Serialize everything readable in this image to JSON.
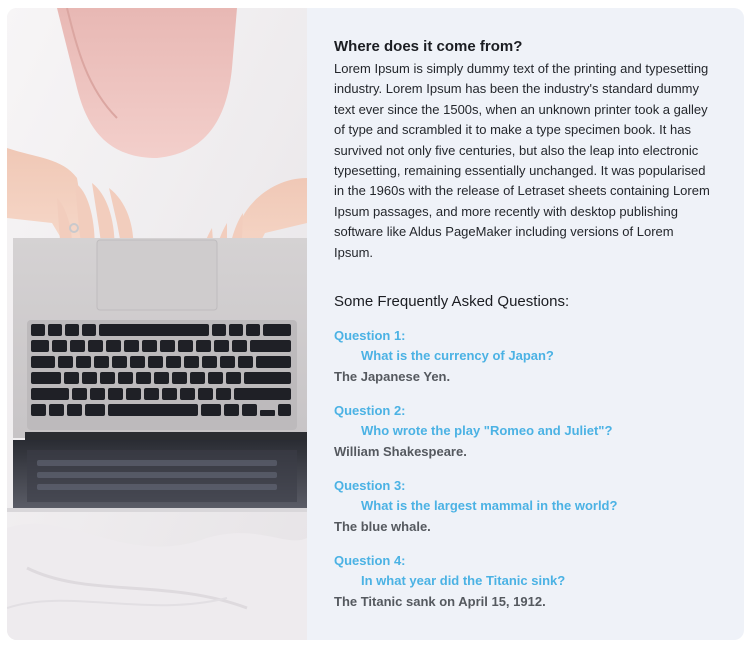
{
  "section": {
    "heading": "Where does it come from?",
    "paragraph": "Lorem Ipsum is simply dummy text of the printing and typesetting industry. Lorem Ipsum has been the industry's standard dummy text ever since the 1500s, when an unknown printer took a galley of type and scrambled it to make a type specimen book. It has survived not only five centuries, but also the leap into electronic typesetting, remaining essentially unchanged. It was popularised in the 1960s with the release of Letraset sheets containing Lorem Ipsum passages, and more recently with desktop publishing software like Aldus PageMaker including versions of Lorem Ipsum."
  },
  "faq": {
    "title": "Some Frequently Asked Questions:",
    "items": [
      {
        "label": "Question 1:",
        "question": "What is the currency of Japan?",
        "answer": "The Japanese Yen."
      },
      {
        "label": "Question 2:",
        "question": "Who wrote the play \"Romeo and Juliet\"?",
        "answer": "William Shakespeare."
      },
      {
        "label": "Question 3:",
        "question": "What is the largest mammal in the world?",
        "answer": "The blue whale."
      },
      {
        "label": "Question 4:",
        "question": "In what year did the Titanic sink?",
        "answer": "The Titanic sank on April 15, 1912."
      }
    ]
  },
  "colors": {
    "card_bg": "#eff2f8",
    "question": "#4bb2e4",
    "answer": "#55595f"
  }
}
